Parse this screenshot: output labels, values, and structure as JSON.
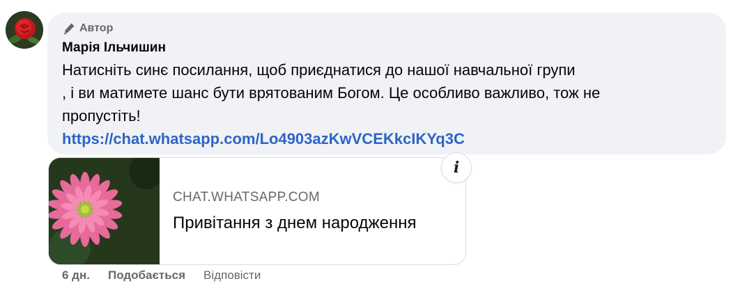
{
  "comment": {
    "author_badge": "Автор",
    "author_name": "Марія Ільчишин",
    "message_lines": [
      "Натисніть синє посилання, щоб приєднатися до нашої навчальної групи",
      ", і ви матимете шанс бути врятованим Богом. Це особливо важливо, тож не",
      "пропустіть!"
    ],
    "link_text": "https://chat.whatsapp.com/Lo4903azKwVCEKkcIKYq3C"
  },
  "link_preview": {
    "domain": "CHAT.WHATSAPP.COM",
    "title": "Привітання з днем народження",
    "info_symbol": "i"
  },
  "actions": {
    "timestamp": "6 дн.",
    "like_label": "Подобається",
    "reply_label": "Відповісти"
  },
  "colors": {
    "link": "#2d64c8",
    "bubble_bg": "#f0f2f5",
    "muted_text": "#65676b"
  },
  "icons": {
    "badge_icon": "pen-icon",
    "avatar_image": "red-rose-avatar",
    "preview_image": "pink-flower-image"
  }
}
